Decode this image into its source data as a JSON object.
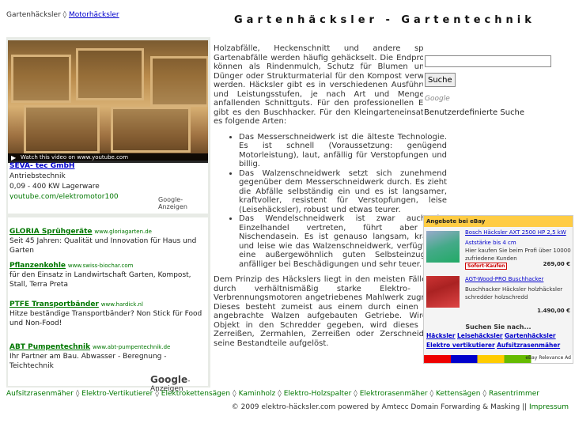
{
  "header": {
    "breadcrumb_home": "Gartenhäcksler",
    "breadcrumb_sep": "◊",
    "breadcrumb_current": "Motorhäcksler",
    "site_title": "Gartenhäcksler - Gartentechnik"
  },
  "video_ad": {
    "player_caption": "Watch this video on www.youtube.com",
    "title": "SEVA- tec GmbH",
    "line1": "Antriebstechnik",
    "line2": "0,09 - 400 KW Lagerware",
    "url": "youtube.com/elektromotor100",
    "google_label": "Google-Anzeigen"
  },
  "text_ads": [
    {
      "title": "GLORIA Sprühgeräte",
      "url": "www.gloriagarten.de",
      "text": "Seit 45 Jahren: Qualität und Innovation für Haus und Garten"
    },
    {
      "title": "Pflanzenkohle",
      "url": "www.swiss-biochar.com",
      "text": "für den Einsatz in Landwirtschaft Garten, Kompost, Stall, Terra Preta"
    },
    {
      "title": "PTFE Transportbänder",
      "url": "www.hardick.nl",
      "text": "Hitze beständige Transportbänder? Non Stick für Food und Non-Food!"
    },
    {
      "title": "ABT Pumpentechnik",
      "url": "www.abt-pumpentechnik.de",
      "text": "Ihr Partner am Bau. Abwasser - Beregnung - Teichtechnik"
    }
  ],
  "text_ads_google": {
    "brand": "Google",
    "suffix": "-Anzeigen"
  },
  "main": {
    "intro": "Holzabfälle, Heckenschnitt und andere sperrige Gartenabfälle werden häufig gehäckselt. Die Endprodukte können als Rindenmulch, Schutz für Blumen und als Dünger oder Strukturmaterial für den Kompost verwendet werden. Häcksler gibt es in verschiedenen Ausführungen und Leistungsstufen, je nach Art und Menge des anfallenden Schnittguts. Für den professionellen Einsatz gibt es den Buschhacker. Für den Kleingarteneinsatz gibt es folgende Arten:",
    "items": [
      "Das Messerschneidwerk ist die älteste Technologie. Es ist schnell (Voraussetzung: genügend Motorleistung), laut, anfällig für Verstopfungen und billig.",
      "Das Walzenschneidwerk setzt sich zunehmend gegenüber dem Messerschneidwerk durch. Es zieht die Abfälle selbständig ein und es ist langsamer, kraftvoller, resistent für Verstopfungen, leise (Leisehäcksler), robust und etwas teurer.",
      "Das Wendelschneidwerk ist zwar auch im Einzelhandel vertreten, führt aber ein Nischendasein. Es ist genauso langsam, kraftvoll und leise wie das Walzenschneidwerk, verfügt über eine außergewöhnlich guten Selbsteinzug, ist anfälliger bei Beschädigungen und sehr teuer."
    ],
    "outro": "Dem Prinzip des Häckslers liegt in den meisten Fällen ein durch verhältnismäßig starke Elektro- oder Verbrennungsmotoren angetriebenes Mahlwerk zugrunde. Dieses besteht zumeist aus einem durch einen Motor angebrachte Walzen aufgebauten Getriebe. Wird ein Objekt in den Schredder gegeben, wird dieses durch Zerreißen, Zermahlen, Zerreißen oder Zerschneiden in seine Bestandteile aufgelöst."
  },
  "search": {
    "input_value": "",
    "button_label": "Suche",
    "logo_text": "Google",
    "label": "Benutzerdefinierte Suche"
  },
  "ebay": {
    "header": "Angebote bei eBay",
    "items": [
      {
        "title": "Bosch Häcksler AXT 2500 HP 2,5 kW",
        "desc1": "Aststärke bis 4 cm",
        "desc2": "Hier kaufen Sie beim Profi über 10000 zufriedene Kunden",
        "badge": "Sofort-Kaufen",
        "price": "269,00 €"
      },
      {
        "title": "AGT-Wood-PRO Buschhacker",
        "desc1": "Buschhacker Häcksler holzhäcksler schredder holzschredd",
        "desc2": "",
        "badge": "",
        "price": "1.490,00 €"
      }
    ],
    "search_title": "Suchen Sie nach...",
    "links": [
      "Häcksler",
      "Leisehäcksler",
      "Gartenhäcksler",
      "Elektro vertikutierer",
      "Aufsitzrasenmäher"
    ],
    "footer": "eBay Relevance Ad"
  },
  "footer": {
    "links": [
      "Aufsitzrasenmäher",
      "Elektro-Vertikutierer",
      "Elektrokettensägen",
      "Kaminholz",
      "Elektro-Holzspalter",
      "Elektrorasenmäher",
      "Kettensägen",
      "Rasentrimmer"
    ],
    "separator": "◊",
    "copyright": "© 2009 elektro-häcksler.com powered by Amtecc Domain Forwarding & Masking ||",
    "impressum": "Impressum"
  },
  "colors": {
    "link": "#0000cc",
    "ad_green": "#007700",
    "ebay_header": "#ffcc44"
  }
}
